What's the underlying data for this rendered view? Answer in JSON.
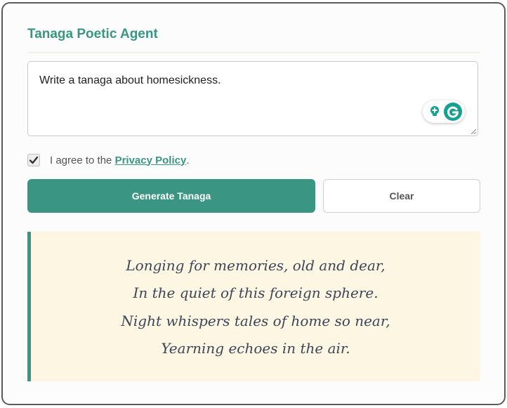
{
  "app": {
    "title": "Tanaga Poetic Agent"
  },
  "prompt": {
    "value": "Write a tanaga about homesickness."
  },
  "consent": {
    "checked": true,
    "text_before": "I agree to the ",
    "link_label": "Privacy Policy",
    "text_after": "."
  },
  "actions": {
    "generate_label": "Generate Tanaga",
    "clear_label": "Clear"
  },
  "poem": {
    "lines": [
      "Longing for memories, old and dear,",
      "In the quiet of this foreign sphere.",
      "Night whispers tales of home so near,",
      "Yearning echoes in the air."
    ]
  },
  "colors": {
    "accent": "#3a9583",
    "poem_background": "#fdf6e3",
    "poem_text": "#3c4658",
    "assistant_icon": "#15a08f"
  },
  "icons": {
    "writing_assistant": [
      "lightbulb-plus-icon",
      "g-logo-icon"
    ],
    "checkbox": "checkmark-icon"
  }
}
